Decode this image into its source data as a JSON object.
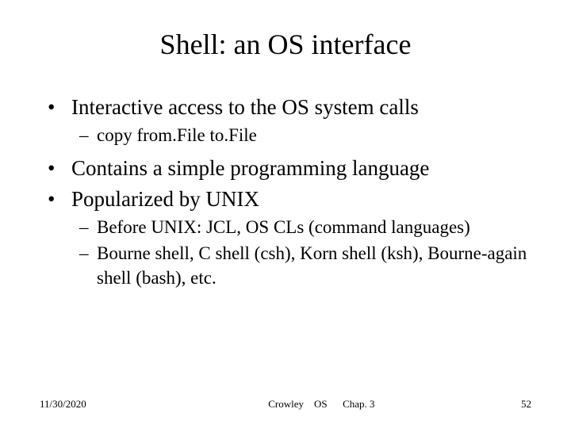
{
  "title": "Shell: an OS interface",
  "bullets": [
    {
      "text": "Interactive access to the OS system calls",
      "subs": [
        "copy from.File to.File"
      ]
    },
    {
      "text": "Contains a simple programming language",
      "subs": []
    },
    {
      "text": "Popularized by UNIX",
      "subs": [
        "Before UNIX: JCL, OS CLs (command languages)",
        "Bourne shell, C shell (csh), Korn shell (ksh), Bourne-again shell (bash), etc."
      ]
    }
  ],
  "footer": {
    "date": "11/30/2020",
    "center": "Crowley OS  Chap. 3",
    "page": "52"
  }
}
